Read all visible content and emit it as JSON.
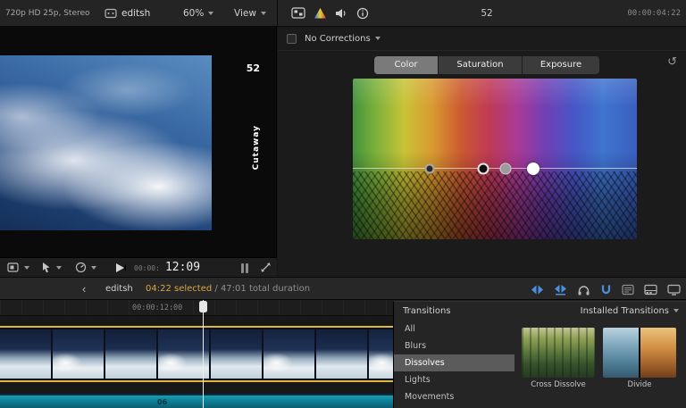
{
  "ui": {
    "back": "‹",
    "reset": "↺"
  },
  "colors": {
    "selection_yellow": "#e0b63c",
    "highlight_orange": "#d9a741",
    "tool_blue": "#4a90e2",
    "audio_teal": "#0e7f95"
  },
  "top_bar": {
    "format_info": "720p HD 25p, Stereo",
    "project_name": "editsh",
    "zoom": "60%",
    "view": "View",
    "clip_number": "52",
    "timecode": "00:00:04:22"
  },
  "viewer": {
    "clip_number": "52",
    "angle_label": "Cutaway"
  },
  "transport": {
    "tc_small": "00:00:",
    "tc_large": "12:09"
  },
  "inspector": {
    "dropdown_label": "No Corrections",
    "tabs": [
      {
        "label": "Color",
        "active": true
      },
      {
        "label": "Saturation",
        "active": false
      },
      {
        "label": "Exposure",
        "active": false
      }
    ]
  },
  "timeline_bar": {
    "project_name": "editsh",
    "selected_duration": "04:22 selected",
    "total_duration": " / 47:01 total duration"
  },
  "timeline": {
    "ruler_timecode": "00:00:12:00",
    "audio_clip_label": "06"
  },
  "transitions": {
    "title": "Transitions",
    "installed_label": "Installed Transitions",
    "categories": [
      "All",
      "Blurs",
      "Dissolves",
      "Lights",
      "Movements"
    ],
    "selected_category": "Dissolves",
    "items": [
      {
        "name": "Cross Dissolve"
      },
      {
        "name": "Divide"
      }
    ]
  }
}
